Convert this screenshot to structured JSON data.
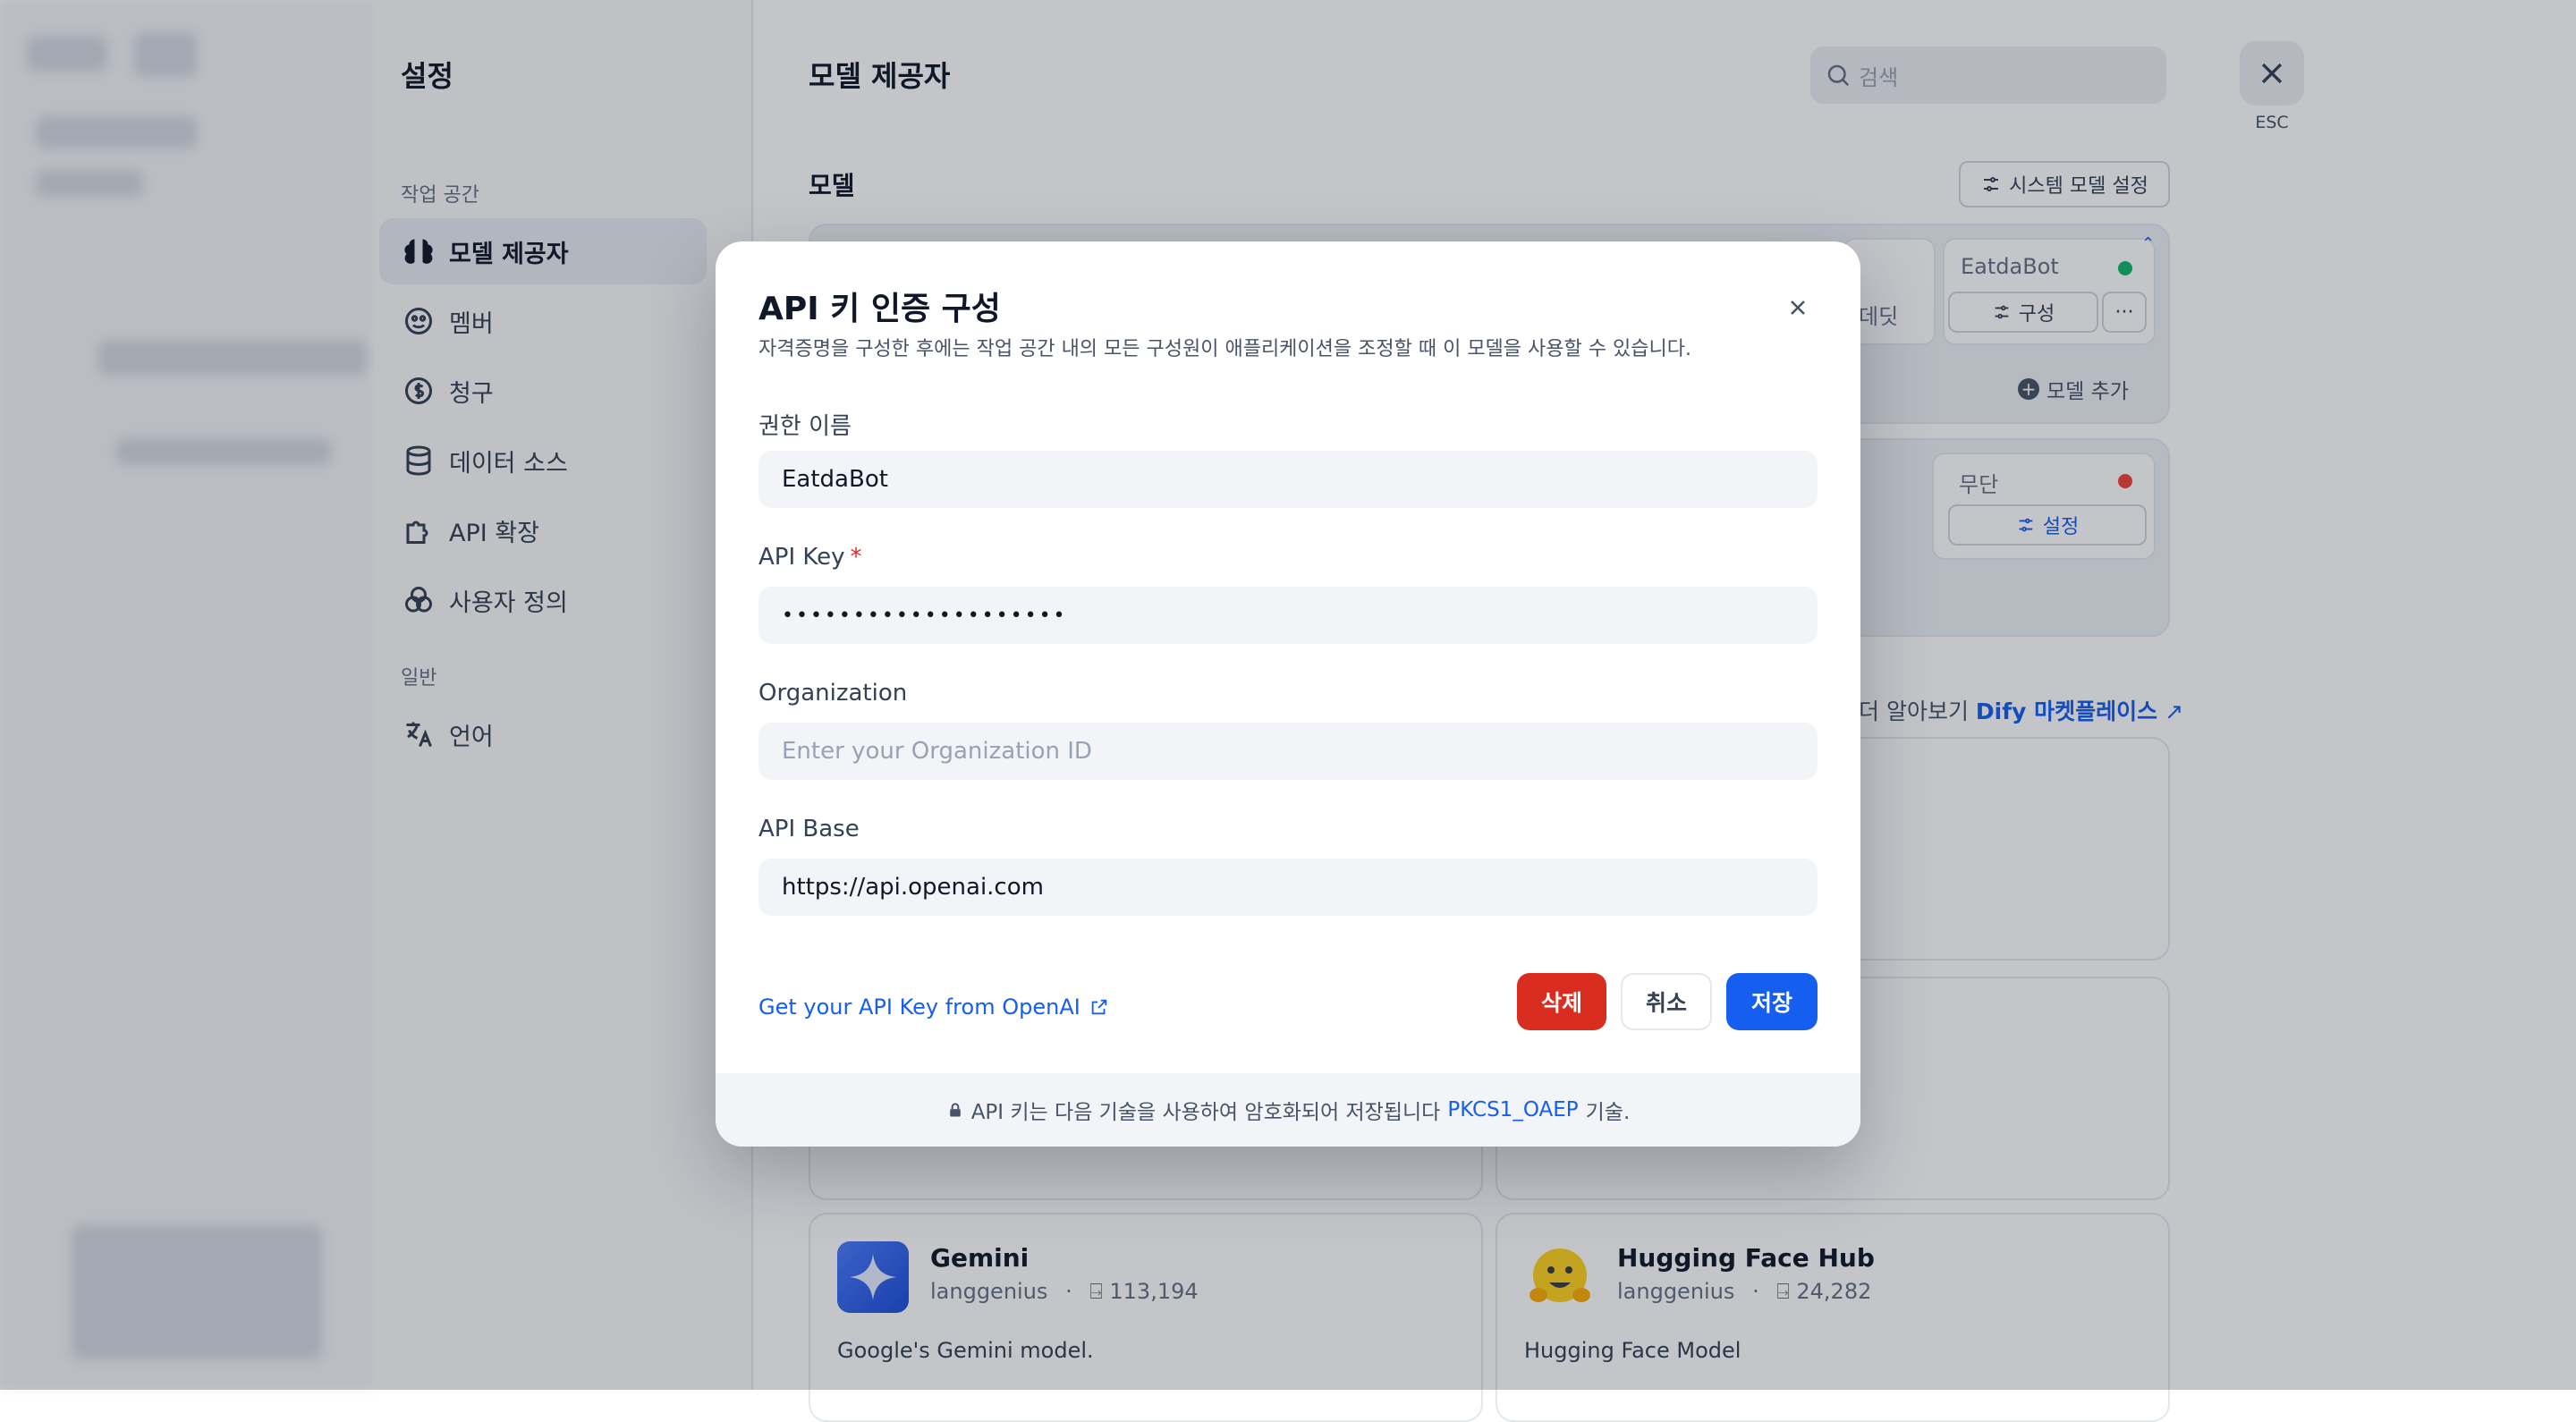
{
  "settings": {
    "title": "설정",
    "workspace_section": "작업 공간",
    "general_section": "일반",
    "items": [
      {
        "label": "모델 제공자",
        "icon": "brain-icon"
      },
      {
        "label": "멤버",
        "icon": "users-icon"
      },
      {
        "label": "청구",
        "icon": "dollar-icon"
      },
      {
        "label": "데이터 소스",
        "icon": "database-icon"
      },
      {
        "label": "API 확장",
        "icon": "puzzle-icon"
      },
      {
        "label": "사용자 정의",
        "icon": "customize-icon"
      }
    ],
    "language_item": {
      "label": "언어",
      "icon": "language-icon"
    }
  },
  "main": {
    "title": "모델 제공자",
    "search_placeholder": "검색",
    "close_hint": "ESC",
    "model_section": "모델",
    "system_model_button": "시스템 모델 설정",
    "provider_card_1": {
      "partial_text": "데딧",
      "credential_name": "EatdaBot",
      "status_color": "#12b76a",
      "config_button": "구성",
      "more_button": "···",
      "add_model": "모델 추가"
    },
    "provider_card_2": {
      "credential_name": "무단",
      "status_color": "#f04438",
      "setup_button": "설정"
    },
    "marketplace": {
      "prefix": "더 알아보기",
      "link": "Dify 마켓플레이스"
    },
    "providers": [
      {
        "name": "Gemini",
        "author": "langgenius",
        "installs": "113,194",
        "description": "Google's Gemini model."
      },
      {
        "name": "Hugging Face Hub",
        "author": "langgenius",
        "installs": "24,282",
        "description": "Hugging Face Model"
      }
    ]
  },
  "modal": {
    "title": "API 키 인증 구성",
    "description": "자격증명을 구성한 후에는 작업 공간 내의 모든 구성원이 애플리케이션을 조정할 때 이 모델을 사용할 수 있습니다.",
    "fields": {
      "name": {
        "label": "권한 이름",
        "value": "EatdaBot"
      },
      "api_key": {
        "label": "API Key",
        "required_mark": "*",
        "value": "••••••••••••••••••••"
      },
      "organization": {
        "label": "Organization",
        "placeholder": "Enter your Organization ID"
      },
      "api_base": {
        "label": "API Base",
        "value": "https://api.openai.com"
      }
    },
    "get_key_link": "Get your API Key from OpenAI",
    "buttons": {
      "delete": "삭제",
      "cancel": "취소",
      "save": "저장"
    },
    "footer": {
      "prefix": "API 키는 다음 기술을 사용하여 암호화되어 저장됩니다",
      "link": "PKCS1_OAEP",
      "suffix": "기술."
    }
  }
}
